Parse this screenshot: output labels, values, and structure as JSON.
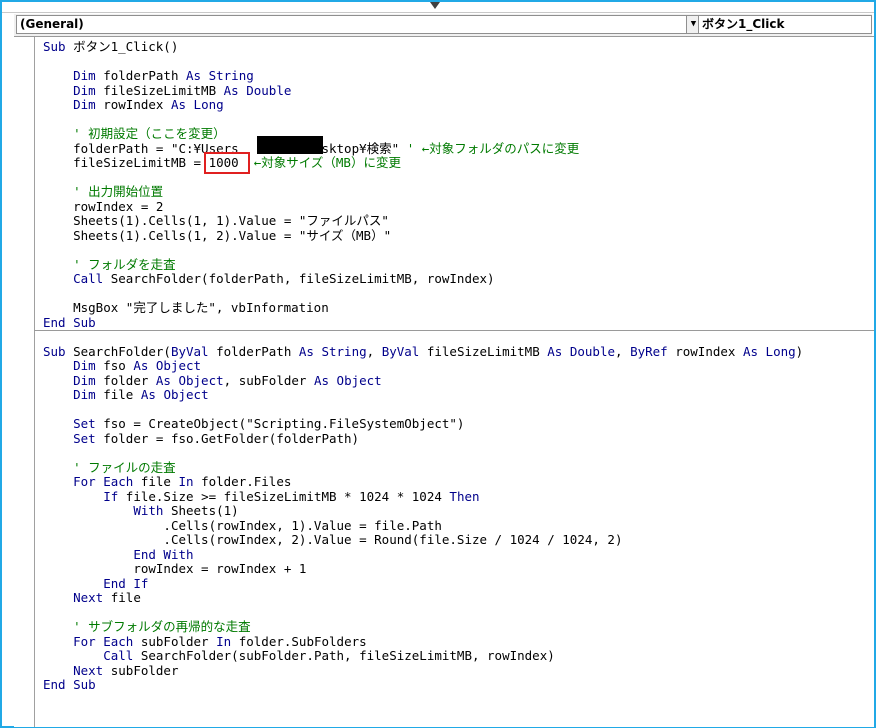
{
  "toolbar": {
    "object_combo": "(General)",
    "procedure_combo": "ボタン1_Click",
    "dropdown_glyph": "▼"
  },
  "colors": {
    "keyword": "#00008b",
    "comment": "#007a00",
    "highlight_box": "#e02020",
    "frame": "#21a9e6"
  },
  "code": {
    "sub1_header": "ボタン1_Click()",
    "decl_folderPath": "folderPath",
    "decl_fileSize": "fileSizeLimitMB",
    "decl_rowIndex": "rowIndex",
    "type_string": "String",
    "type_double": "Double",
    "type_long": "Long",
    "comment_init": "' 初期設定（ここを変更）",
    "folderPath_assign_a": "folderPath = \"C:¥Users",
    "folderPath_assign_b": "Desktop¥検索\"",
    "comment_folder_change": "' ←対象フォルダのパスに変更",
    "fileSize_assign": "fileSizeLimitMB = ",
    "fileSize_value": "1000",
    "comment_size_change": "←対象サイズ（MB）に変更",
    "comment_output_start": "' 出力開始位置",
    "rowIndex_assign": "rowIndex = 2",
    "sheet_cell1": "Sheets(1).Cells(1, 1).Value = \"ファイルパス\"",
    "sheet_cell2": "Sheets(1).Cells(1, 2).Value = \"サイズ（MB）\"",
    "comment_scan_folder": "' フォルダを走査",
    "call_search": " SearchFolder(folderPath, fileSizeLimitMB, rowIndex)",
    "msgbox": "MsgBox \"完了しました\", vbInformation",
    "sub2_name": " SearchFolder(",
    "sub2_p1": " folderPath ",
    "sub2_p2": " fileSizeLimitMB ",
    "sub2_p3": " rowIndex ",
    "decl_fso": "fso",
    "type_object": "Object",
    "decl_folder": "folder",
    "decl_subFolder": "subFolder",
    "decl_file": "file",
    "set_fso": " fso = CreateObject(\"Scripting.FileSystemObject\")",
    "set_folder": " folder = fso.GetFolder(folderPath)",
    "comment_scan_files": "' ファイルの走査",
    "for_each_file": " file ",
    "folder_files": " folder.Files",
    "if_cond": " file.Size >= fileSizeLimitMB * 1024 * 1024 ",
    "with_sheets": " Sheets(1)",
    "cells_path": ".Cells(rowIndex, 1).Value = file.Path",
    "cells_size": ".Cells(rowIndex, 2).Value = Round(file.Size / 1024 / 1024, 2)",
    "rowIndex_inc": "rowIndex = rowIndex + 1",
    "next_file": " file",
    "comment_subfolder": "' サブフォルダの再帰的な走査",
    "for_each_sub": " subFolder ",
    "folder_subfolders": " folder.SubFolders",
    "call_recursive": " SearchFolder(subFolder.Path, fileSizeLimitMB, rowIndex)",
    "next_sub": " subFolder"
  }
}
